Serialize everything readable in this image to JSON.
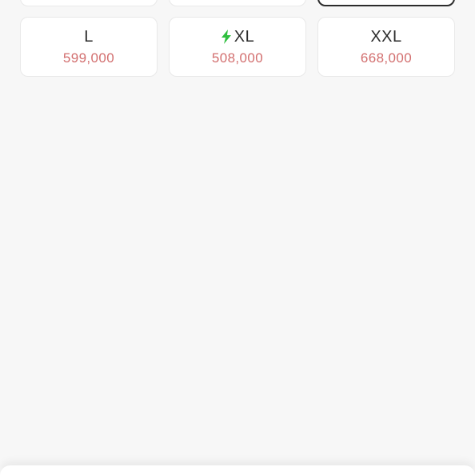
{
  "sizes": {
    "top_row": [
      {
        "label": "",
        "price": "",
        "selected": false
      },
      {
        "label": "",
        "price": "",
        "selected": false
      },
      {
        "label": "",
        "price": "",
        "selected": true
      }
    ],
    "options": [
      {
        "label": "L",
        "price": "599,000",
        "fast": false
      },
      {
        "label": "XL",
        "price": "508,000",
        "fast": true
      },
      {
        "label": "XXL",
        "price": "668,000",
        "fast": false
      }
    ]
  },
  "colors": {
    "price": "#d26e6e",
    "bolt": "#2fbf3f",
    "selected_border": "#2c2c2c"
  },
  "icons": {
    "fast_delivery": "lightning-bolt-icon"
  }
}
